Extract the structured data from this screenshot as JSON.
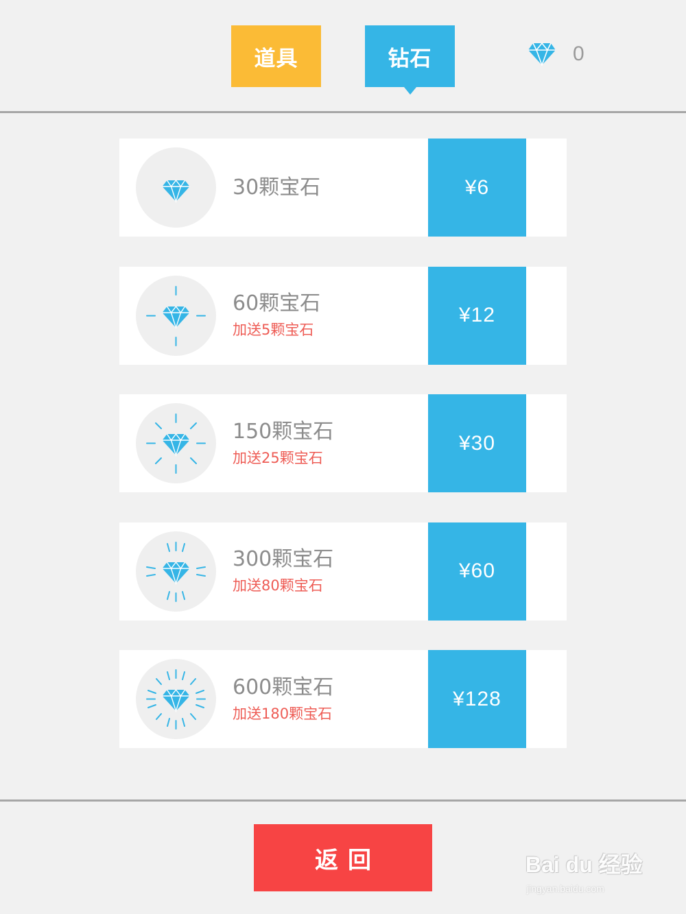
{
  "tabs": [
    {
      "label": "道具",
      "active": false,
      "color": "#fbbb36"
    },
    {
      "label": "钻石",
      "active": true,
      "color": "#35b5e6"
    }
  ],
  "balance": {
    "icon": "diamond-icon",
    "count": "0"
  },
  "items": [
    {
      "title": "30颗宝石",
      "bonus": "",
      "price": "¥6",
      "icon": "diamond-icon"
    },
    {
      "title": "60颗宝石",
      "bonus": "加送5颗宝石",
      "price": "¥12",
      "icon": "diamond-sparkle-icon"
    },
    {
      "title": "150颗宝石",
      "bonus": "加送25颗宝石",
      "price": "¥30",
      "icon": "diamond-sparkle-icon"
    },
    {
      "title": "300颗宝石",
      "bonus": "加送80颗宝石",
      "price": "¥60",
      "icon": "diamond-sparkle-icon"
    },
    {
      "title": "600颗宝石",
      "bonus": "加送180颗宝石",
      "price": "¥128",
      "icon": "diamond-sparkle-icon"
    }
  ],
  "back_button": {
    "label": "返回",
    "color": "#f74444"
  },
  "watermark": {
    "brand": "Bai du 经验",
    "url": "jingyan.baidu.com"
  },
  "colors": {
    "accent": "#35b5e6",
    "bonus_text": "#ee5c55",
    "background": "#f1f1f1"
  }
}
